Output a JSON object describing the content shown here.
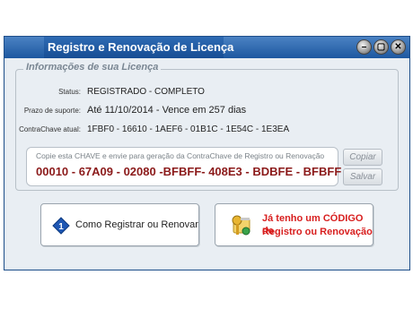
{
  "window": {
    "title": "Registro e Renovação de Licença",
    "controls": {
      "minimize": "–",
      "restore": "▢",
      "close": "✕"
    }
  },
  "license_group": {
    "legend": "Informações de sua Licença",
    "status_label": "Status:",
    "status_value": "REGISTRADO - COMPLETO",
    "support_label": "Prazo de suporte:",
    "support_value": "Até 11/10/2014 - Vence em 257 dias",
    "counterkey_label": "ContraChave atual:",
    "counterkey_value": "1FBF0 - 16610 - 1AEF6 - 01B1C - 1E54C - 1E3EA",
    "chave_hint": "Copie esta CHAVE e envie para geração da ContraChave de Registro ou Renovação",
    "chave_code": "00010 - 67A09 - 02080 -BFBFF- 408E3 - BDBFE - BFBFF",
    "copy_button": "Copiar",
    "save_button": "Salvar"
  },
  "actions": {
    "register_button": "Como Registrar ou Renovar",
    "have_code_line1": "Já tenho um CÓDIGO de",
    "have_code_line2": "Registro ou Renovação"
  },
  "colors": {
    "titlebar": "#1d58a0",
    "chave_code": "#8b1a1a",
    "have_code_text": "#d81e1e"
  }
}
